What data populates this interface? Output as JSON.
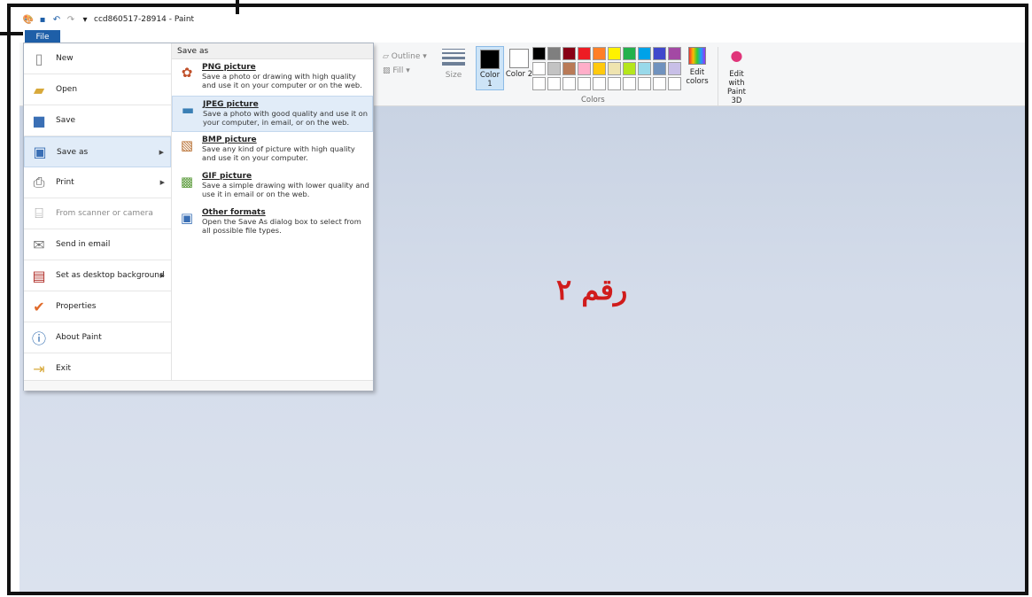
{
  "window": {
    "title": "ccd860517-28914 - Paint",
    "file_tab": "File"
  },
  "quick_access": [
    "paint-app-icon",
    "save-icon",
    "undo-icon",
    "redo-icon",
    "customize-icon"
  ],
  "ribbon": {
    "outline_label": "Outline",
    "fill_label": "Fill",
    "size_label": "Size",
    "color1_label": "Color 1",
    "color2_label": "Color 2",
    "edit_colors_label": "Edit colors",
    "edit_paint3d_label": "Edit with Paint 3D",
    "colors_group_label": "Colors",
    "color1_value": "#000000",
    "color2_value": "#ffffff",
    "palette": [
      "#000000",
      "#7f7f7f",
      "#880015",
      "#ed1c24",
      "#ff7f27",
      "#fff200",
      "#22b14c",
      "#00a2e8",
      "#3f48cc",
      "#a349a4",
      "#ffffff",
      "#c3c3c3",
      "#b97a57",
      "#ffaec9",
      "#ffc90e",
      "#efe4b0",
      "#b5e61d",
      "#99d9ea",
      "#7092be",
      "#c8bfe7",
      "#ffffff",
      "#ffffff",
      "#ffffff",
      "#ffffff",
      "#ffffff",
      "#ffffff",
      "#ffffff",
      "#ffffff",
      "#ffffff",
      "#ffffff"
    ]
  },
  "file_menu": {
    "items": [
      {
        "label": "New",
        "icon": "new-file-icon"
      },
      {
        "label": "Open",
        "icon": "open-folder-icon"
      },
      {
        "label": "Save",
        "icon": "save-icon"
      },
      {
        "label": "Save as",
        "icon": "save-as-icon"
      },
      {
        "label": "Print",
        "icon": "printer-icon"
      },
      {
        "label": "From scanner or camera",
        "icon": "scanner-icon"
      },
      {
        "label": "Send in email",
        "icon": "email-icon"
      },
      {
        "label": "Set as desktop background",
        "icon": "desktop-icon"
      },
      {
        "label": "Properties",
        "icon": "checkmark-icon"
      },
      {
        "label": "About Paint",
        "icon": "info-icon"
      },
      {
        "label": "Exit",
        "icon": "exit-icon"
      }
    ],
    "save_as": {
      "header": "Save as",
      "items": [
        {
          "title": "PNG picture",
          "desc": "Save a photo or drawing with high quality and use it on your computer or on the web."
        },
        {
          "title": "JPEG picture",
          "desc": "Save a photo with good quality and use it on your computer, in email, or on the web."
        },
        {
          "title": "BMP picture",
          "desc": "Save any kind of picture with high quality and use it on your computer."
        },
        {
          "title": "GIF picture",
          "desc": "Save a simple drawing with lower quality and use it in email or on the web."
        },
        {
          "title": "Other formats",
          "desc": "Open the Save As dialog box to select from all possible file types."
        }
      ]
    }
  },
  "overlay_text": "رقم ٢"
}
